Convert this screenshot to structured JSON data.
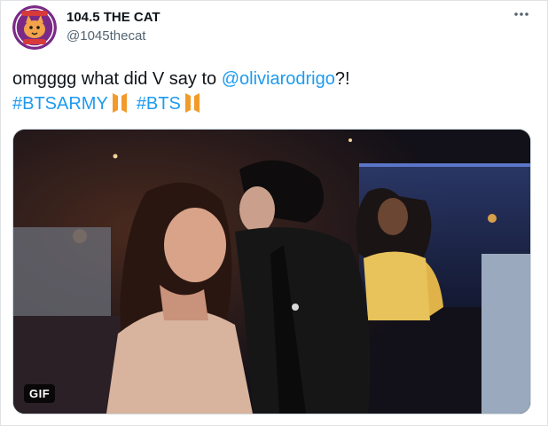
{
  "account": {
    "display_name": "104.5 THE CAT",
    "handle": "@1045thecat",
    "avatar_logo_text": "104.5 THE CAT"
  },
  "tweet": {
    "text_before_mention": "omgggg what did V say to ",
    "mention": "@oliviarodrigo",
    "text_after_mention": "?!",
    "hashtags": [
      "#BTSARMY",
      "#BTS"
    ]
  },
  "media": {
    "badge": "GIF"
  },
  "icons": {
    "more": "more-options-icon",
    "hashtag_emoji": "bts-logo-emoji"
  },
  "colors": {
    "link": "#1d9bf0",
    "bts_emoji": "#f29b2b",
    "text": "#0f1419",
    "secondary_text": "#536471"
  }
}
